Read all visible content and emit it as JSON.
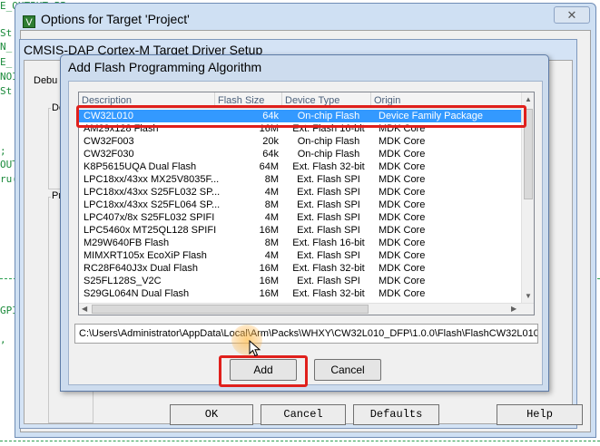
{
  "code_background": {
    "lines": [
      "E_OUTPUT_PP;",
      "St",
      "N_",
      "E_",
      "NOI",
      "St",
      ";",
      "OUT",
      "ru(",
      "GPI",
      ","
    ]
  },
  "options_window": {
    "title": "Options for Target 'Project'",
    "title_icon": "keil-icon",
    "close_glyph": "✕"
  },
  "driver_window": {
    "title": "CMSIS-DAP Cortex-M Target Driver Setup",
    "tab_label": "Debu",
    "group1_label": "Do",
    "group2_label": "Pro"
  },
  "bottom_buttons": {
    "ok": "OK",
    "cancel": "Cancel",
    "defaults": "Defaults",
    "help": "Help"
  },
  "add_dialog": {
    "title": "Add Flash Programming Algorithm",
    "columns": [
      "Description",
      "Flash Size",
      "Device Type",
      "Origin"
    ],
    "rows": [
      {
        "description": "CW32L010",
        "size": "64k",
        "type": "On-chip Flash",
        "origin": "Device Family Package"
      },
      {
        "description": "AM29x128 Flash",
        "size": "16M",
        "type": "Ext. Flash 16-bit",
        "origin": "MDK Core"
      },
      {
        "description": "CW32F003",
        "size": "20k",
        "type": "On-chip Flash",
        "origin": "MDK Core"
      },
      {
        "description": "CW32F030",
        "size": "64k",
        "type": "On-chip Flash",
        "origin": "MDK Core"
      },
      {
        "description": "K8P5615UQA Dual Flash",
        "size": "64M",
        "type": "Ext. Flash 32-bit",
        "origin": "MDK Core"
      },
      {
        "description": "LPC18xx/43xx MX25V8035F...",
        "size": "8M",
        "type": "Ext. Flash SPI",
        "origin": "MDK Core"
      },
      {
        "description": "LPC18xx/43xx S25FL032 SP...",
        "size": "4M",
        "type": "Ext. Flash SPI",
        "origin": "MDK Core"
      },
      {
        "description": "LPC18xx/43xx S25FL064 SP...",
        "size": "8M",
        "type": "Ext. Flash SPI",
        "origin": "MDK Core"
      },
      {
        "description": "LPC407x/8x S25FL032 SPIFI",
        "size": "4M",
        "type": "Ext. Flash SPI",
        "origin": "MDK Core"
      },
      {
        "description": "LPC5460x MT25QL128 SPIFI",
        "size": "16M",
        "type": "Ext. Flash SPI",
        "origin": "MDK Core"
      },
      {
        "description": "M29W640FB Flash",
        "size": "8M",
        "type": "Ext. Flash 16-bit",
        "origin": "MDK Core"
      },
      {
        "description": "MIMXRT105x EcoXiP Flash",
        "size": "4M",
        "type": "Ext. Flash SPI",
        "origin": "MDK Core"
      },
      {
        "description": "RC28F640J3x Dual Flash",
        "size": "16M",
        "type": "Ext. Flash 32-bit",
        "origin": "MDK Core"
      },
      {
        "description": "S25FL128S_V2C",
        "size": "16M",
        "type": "Ext. Flash SPI",
        "origin": "MDK Core"
      },
      {
        "description": "S29GL064N Dual Flash",
        "size": "16M",
        "type": "Ext. Flash 32-bit",
        "origin": "MDK Core"
      }
    ],
    "path": "C:\\Users\\Administrator\\AppData\\Local\\Arm\\Packs\\WHXY\\CW32L010_DFP\\1.0.0\\Flash\\FlashCW32L010",
    "add_label": "Add",
    "cancel_label": "Cancel"
  },
  "colors": {
    "selection": "#3399ff",
    "annotation_red": "#e0201c",
    "code_green": "#1a8a3a"
  }
}
